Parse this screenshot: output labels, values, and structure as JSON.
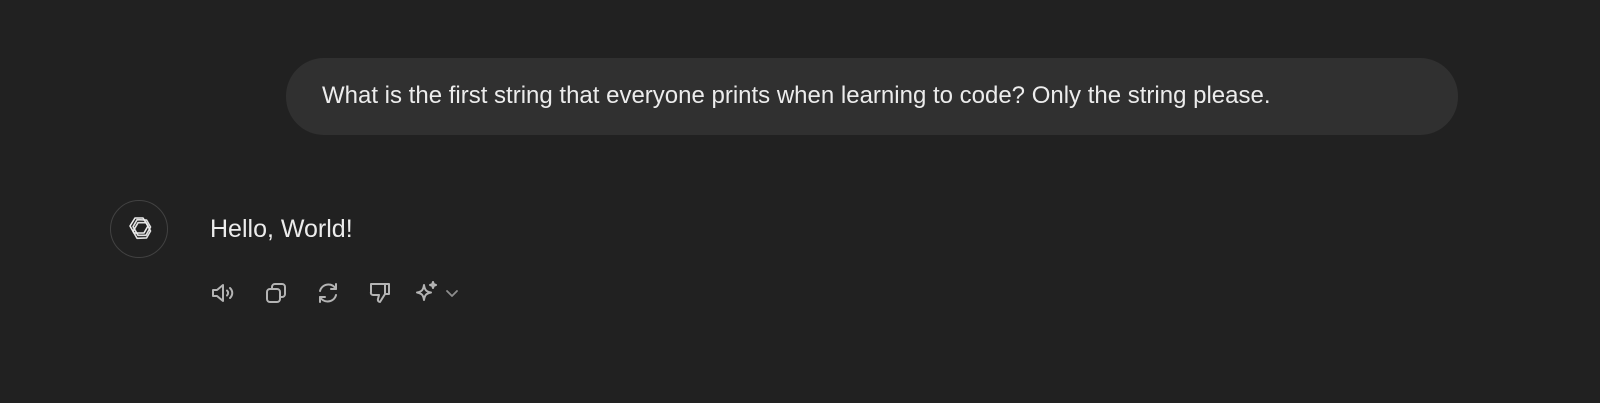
{
  "conversation": {
    "user_message": "What is the first string that everyone prints when learning to code? Only the string please.",
    "assistant_message": "Hello, World!"
  },
  "icons": {
    "avatar": "openai-logo-icon",
    "read_aloud": "speaker-icon",
    "copy": "copy-icon",
    "regenerate": "refresh-icon",
    "bad_response": "thumbs-down-icon",
    "model_switch": "sparkle-icon",
    "model_dropdown": "chevron-down-icon"
  },
  "colors": {
    "background": "#212121",
    "user_bubble": "#303030",
    "text": "#ececec",
    "icon": "#b4b4b4"
  }
}
